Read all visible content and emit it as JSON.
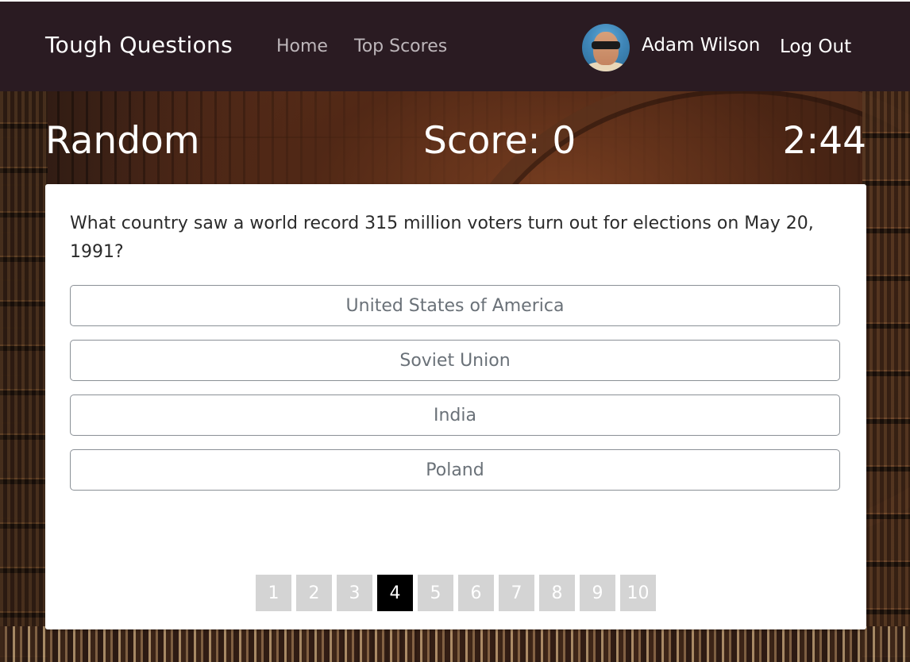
{
  "navbar": {
    "brand": "Tough Questions",
    "links": {
      "home": "Home",
      "top_scores": "Top Scores"
    },
    "user": {
      "name": "Adam Wilson",
      "logout": "Log Out"
    }
  },
  "game": {
    "category": "Random",
    "score_label": "Score: 0",
    "timer": "2:44"
  },
  "question": {
    "text": "What country saw a world record 315 million voters turn out for elections on May 20, 1991?",
    "answers": [
      "United States of America",
      "Soviet Union",
      "India",
      "Poland"
    ]
  },
  "pagination": {
    "pages": [
      "1",
      "2",
      "3",
      "4",
      "5",
      "6",
      "7",
      "8",
      "9",
      "10"
    ],
    "current": "4"
  },
  "colors": {
    "navbar_bg": "#2a1b22",
    "active_page": "#000000",
    "inactive_page": "#d4d4d4"
  }
}
